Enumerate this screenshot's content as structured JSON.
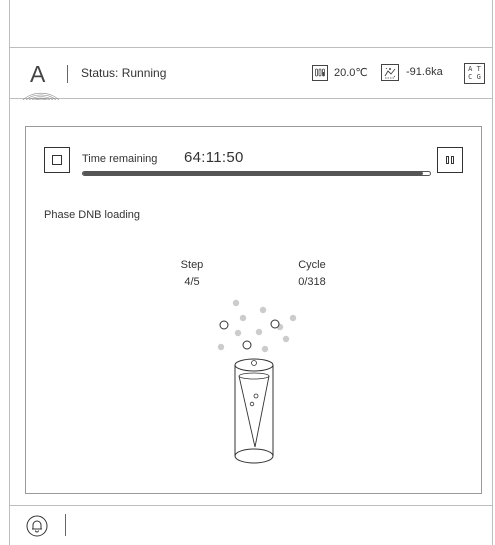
{
  "header": {
    "logo_letter": "A",
    "status_text": "Status: Running",
    "temperature": "20.0℃",
    "pressure": "-91.6ka",
    "atcg_top": "A T",
    "atcg_bottom": "C G"
  },
  "run": {
    "time_label": "Time remaining",
    "time_value": "64:11:50",
    "progress_fraction": 0.98,
    "phase": "Phase DNB loading",
    "step_label": "Step",
    "step_value": "4/5",
    "cycle_label": "Cycle",
    "cycle_value": "0/318"
  },
  "icons": {
    "logo": "brand-logo",
    "temperature": "thermometer-icon",
    "pressure": "pressure-icon",
    "atcg": "atcg-icon",
    "stop": "stop-icon",
    "pause": "pause-icon",
    "bell": "bell-icon"
  },
  "colors": {
    "border": "#bdbdbd",
    "text": "#333333",
    "bead": "#cccccc"
  }
}
